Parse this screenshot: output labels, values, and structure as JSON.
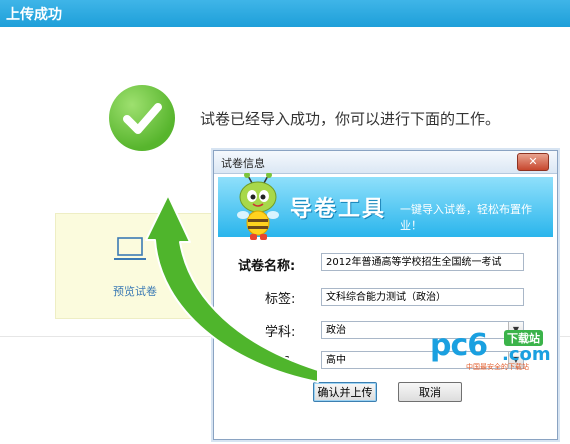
{
  "page": {
    "title": "上传成功"
  },
  "main": {
    "success_message": "试卷已经导入成功，你可以进行下面的工作。",
    "preview_label": "预览试卷"
  },
  "dialog": {
    "title": "试卷信息",
    "close_symbol": "✕",
    "banner": {
      "brand": "导卷工具",
      "slogan": "一键导入试卷，轻松布置作业！"
    },
    "form": {
      "name_label": "试卷名称:",
      "name_value": "2012年普通高等学校招生全国统一考试",
      "tag_label": "标签:",
      "tag_value": "文科综合能力测试（政治）",
      "subject_label": "学科:",
      "subject_value": "政治",
      "level_label": "学段:",
      "level_value": "高中"
    },
    "buttons": {
      "confirm": "确认并上传",
      "cancel": "取消"
    }
  },
  "watermark": {
    "logo": "pc6",
    "badge": "下载站",
    "domain": ".com",
    "tagline": "中国最安全的下载站"
  },
  "colors": {
    "accent": "#1e9fd9",
    "success": "#57b52d",
    "arrow": "#4fb52c"
  }
}
